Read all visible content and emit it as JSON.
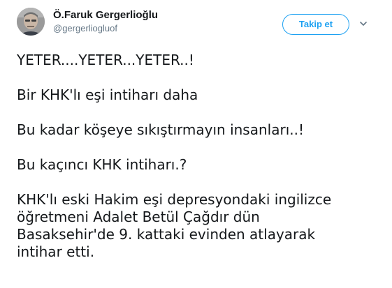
{
  "author": {
    "name": "Ö.Faruk Gergerlioğlu",
    "handle": "@gergerliogluof",
    "avatar_icon": "profile-photo"
  },
  "actions": {
    "follow_label": "Takip et",
    "menu_icon": "chevron-down-icon"
  },
  "tweet": {
    "paragraphs": [
      [
        "YETER....YETER...YETER..!"
      ],
      [
        "Bir KHK'lı eşi intiharı daha"
      ],
      [
        "Bu kadar köşeye sıkıştırmayın insanları..!"
      ],
      [
        "Bu kaçıncı KHK intiharı.?"
      ],
      [
        "KHK'lı eski Hakim eşi depresyondaki ingilizce",
        "öğretmeni Adalet Betül Çağdır dün",
        "Basaksehir'de 9. kattaki evinden atlayarak",
        "intihar etti."
      ]
    ]
  },
  "colors": {
    "accent": "#1da1f2",
    "text": "#14171a",
    "secondary": "#657786"
  }
}
